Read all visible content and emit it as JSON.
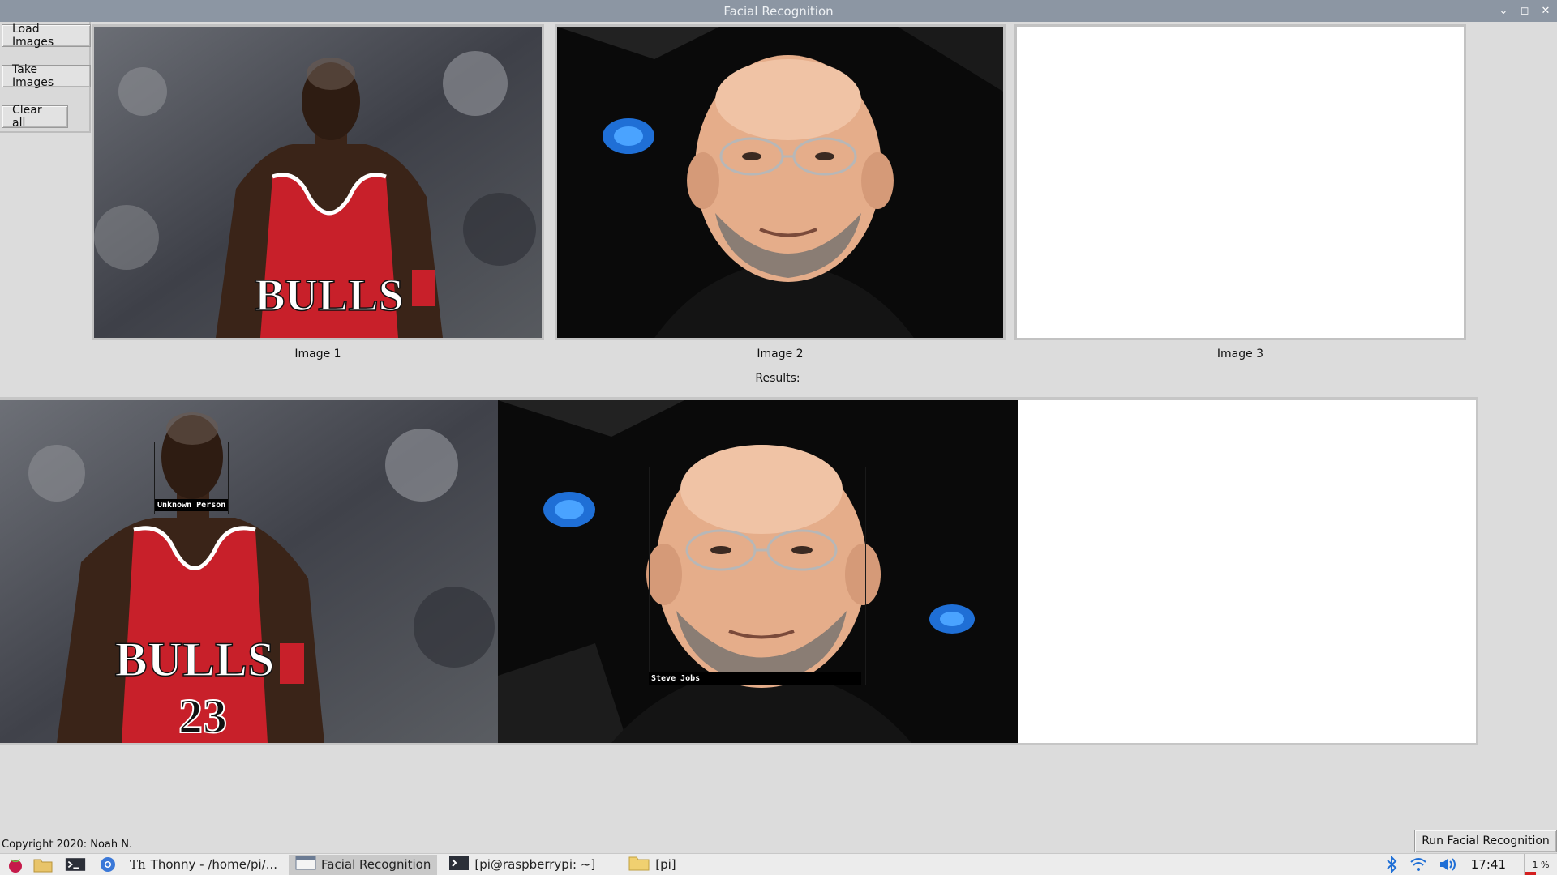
{
  "window": {
    "title": "Facial Recognition",
    "controls": [
      "minimize-icon",
      "maximize-icon",
      "close-icon"
    ]
  },
  "sidebar": {
    "buttons": [
      {
        "label": "Load Images"
      },
      {
        "label": "Take Images"
      },
      {
        "label": "Clear all"
      }
    ]
  },
  "images": {
    "captions": [
      "Image 1",
      "Image 2",
      "Image 3"
    ]
  },
  "results": {
    "label": "Results:",
    "detections": [
      {
        "name": "Unknown Person"
      },
      {
        "name": "Steve Jobs"
      }
    ]
  },
  "footer": {
    "copyright": "Copyright 2020: Noah N.",
    "run_button": "Run Facial Recognition"
  },
  "taskbar": {
    "tasks": [
      {
        "label": "Thonny  -  /home/pi/...",
        "icon": "thonny-icon"
      },
      {
        "label": "Facial Recognition",
        "icon": "window-icon",
        "active": true
      },
      {
        "label": "[pi@raspberrypi: ~]",
        "icon": "terminal-icon"
      },
      {
        "label": "[pi]",
        "icon": "folder-icon"
      }
    ],
    "clock": "17:41",
    "cpu": "1 %"
  },
  "colors": {
    "titlebar": "#8c96a3",
    "jersey_red": "#c8202a",
    "bluetooth": "#1f6fd6"
  }
}
